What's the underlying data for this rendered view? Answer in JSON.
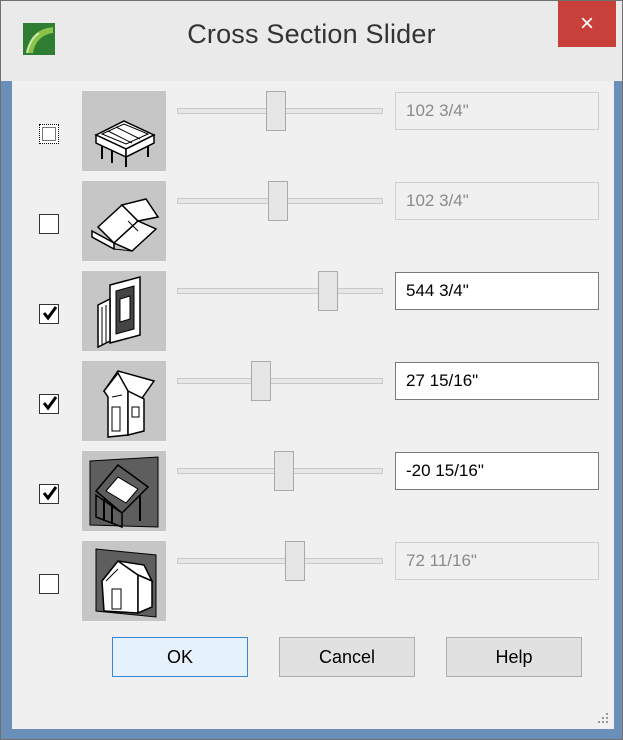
{
  "window": {
    "title": "Cross Section Slider",
    "close_label": "×"
  },
  "rows": [
    {
      "checked": false,
      "focused": true,
      "enabled": false,
      "slider_fraction": 0.48,
      "value": "102 3/4\""
    },
    {
      "checked": false,
      "focused": false,
      "enabled": false,
      "slider_fraction": 0.49,
      "value": "102 3/4\""
    },
    {
      "checked": true,
      "focused": false,
      "enabled": true,
      "slider_fraction": 0.76,
      "value": "544 3/4\""
    },
    {
      "checked": true,
      "focused": false,
      "enabled": true,
      "slider_fraction": 0.4,
      "value": "27 15/16\""
    },
    {
      "checked": true,
      "focused": false,
      "enabled": true,
      "slider_fraction": 0.52,
      "value": "-20 15/16\""
    },
    {
      "checked": false,
      "focused": false,
      "enabled": false,
      "slider_fraction": 0.58,
      "value": "72 11/16\""
    }
  ],
  "buttons": {
    "ok": "OK",
    "cancel": "Cancel",
    "help": "Help"
  },
  "colors": {
    "close_red": "#c7403a",
    "default_button_border": "#3b83d6",
    "app_icon_green": "#2e7d32"
  }
}
